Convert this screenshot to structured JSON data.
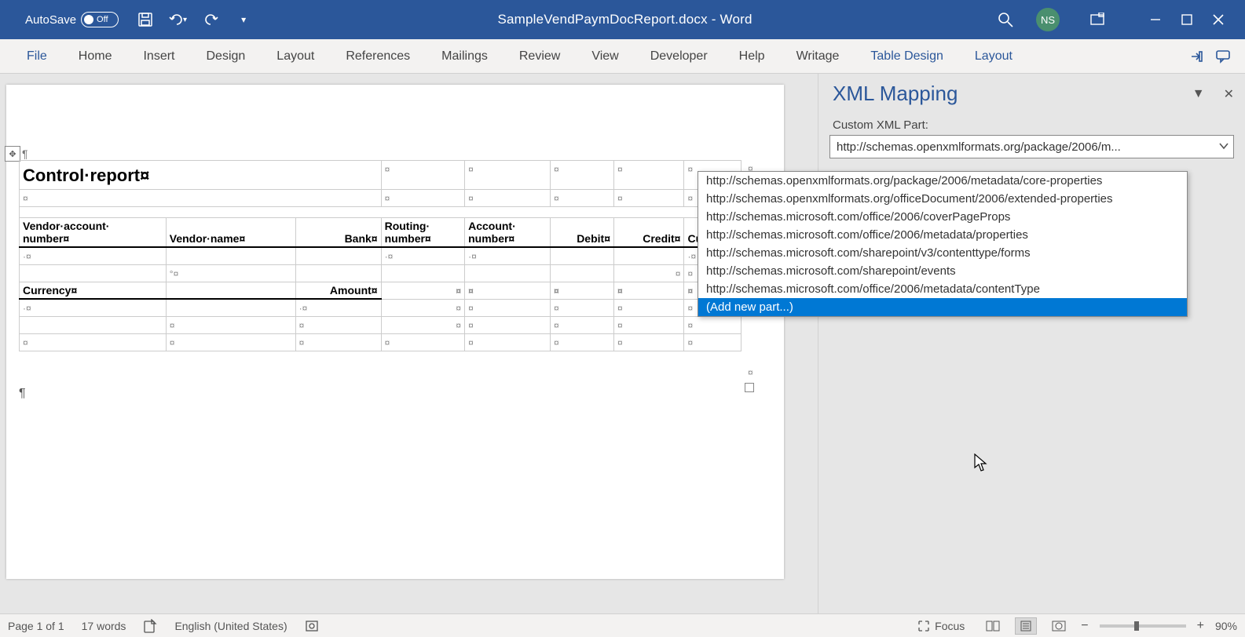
{
  "title_bar": {
    "autosave_label": "AutoSave",
    "autosave_state": "Off",
    "document_title": "SampleVendPaymDocReport.docx - Word",
    "user_initials": "NS"
  },
  "ribbon": {
    "tabs": [
      "File",
      "Home",
      "Insert",
      "Design",
      "Layout",
      "References",
      "Mailings",
      "Review",
      "View",
      "Developer",
      "Help",
      "Writage",
      "Table Design",
      "Layout"
    ]
  },
  "document": {
    "control_report_title": "Control·report¤",
    "headers_row1": {
      "vendor_account": "Vendor·account·",
      "number": "number¤",
      "vendor_name": "Vendor·name¤",
      "bank": "Bank¤",
      "routing": "Routing·",
      "routing_number": "number¤",
      "account": "Account·",
      "account_number": "number¤",
      "debit": "Debit¤",
      "credit": "Credit¤",
      "currency": "Curre"
    },
    "sub_headers": {
      "currency": "Currency¤",
      "amount": "Amount¤"
    }
  },
  "xml_pane": {
    "title": "XML Mapping",
    "label": "Custom XML Part:",
    "selected": "http://schemas.openxmlformats.org/package/2006/m...",
    "options": [
      "http://schemas.openxmlformats.org/package/2006/metadata/core-properties",
      "http://schemas.openxmlformats.org/officeDocument/2006/extended-properties",
      "http://schemas.microsoft.com/office/2006/coverPageProps",
      "http://schemas.microsoft.com/office/2006/metadata/properties",
      "http://schemas.microsoft.com/sharepoint/v3/contenttype/forms",
      "http://schemas.microsoft.com/sharepoint/events",
      "http://schemas.microsoft.com/office/2006/metadata/contentType",
      "(Add new part...)"
    ]
  },
  "statusbar": {
    "page": "Page 1 of 1",
    "words": "17 words",
    "language": "English (United States)",
    "focus": "Focus",
    "zoom": "90%"
  }
}
